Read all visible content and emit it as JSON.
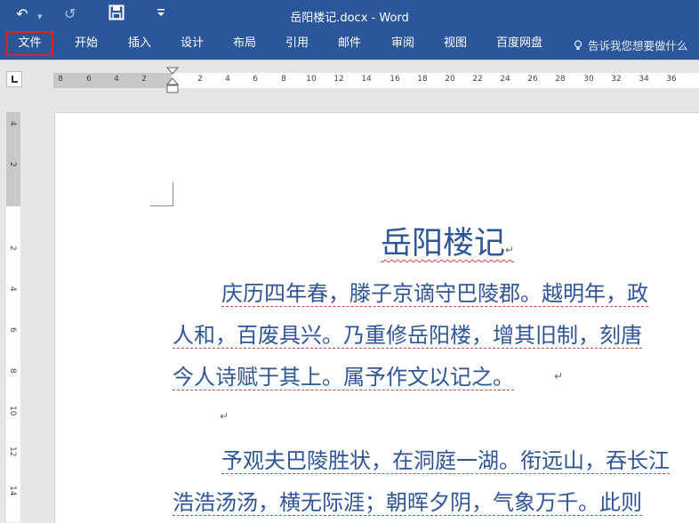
{
  "titlebar": {
    "undo_icon": "undo-icon",
    "redo_icon": "redo-icon",
    "save_icon": "save-icon",
    "customize_icon": "customize-toolbar-icon",
    "title": "岳阳楼记.docx - Word",
    "colors": {
      "brand": "#2b579a"
    }
  },
  "ribbon": {
    "file_label": "文件",
    "tabs": [
      "开始",
      "插入",
      "设计",
      "布局",
      "引用",
      "邮件",
      "审阅",
      "视图",
      "百度网盘"
    ],
    "tell_me": "告诉我您想要做什么",
    "tell_me_icon": "lightbulb-icon",
    "highlight_color": "#e0201f"
  },
  "ruler": {
    "horizontal_labels": [
      "8",
      "6",
      "4",
      "2",
      "2",
      "4",
      "6",
      "8",
      "10",
      "12",
      "14",
      "16",
      "18",
      "20",
      "22",
      "24",
      "26",
      "28",
      "30",
      "32",
      "34",
      "36"
    ],
    "vertical_labels": [
      "4",
      "2",
      "2",
      "4",
      "6",
      "8",
      "10",
      "12",
      "14"
    ]
  },
  "document": {
    "heading": "岳阳楼记",
    "lines": [
      "庆历四年春，滕子京谪守巴陵郡。越明年，政",
      "人和，百废具兴。乃重修岳阳楼，增其旧制，刻唐",
      "今人诗赋于其上。属予作文以记之。",
      "予观夫巴陵胜状，在洞庭一湖。衔远山，吞长江",
      "浩浩汤汤，横无际涯；朝晖夕阴，气象万千。此则"
    ],
    "paragraph_mark": "↵",
    "text_color": "#2f5597",
    "proofing_color": "#e04040"
  }
}
